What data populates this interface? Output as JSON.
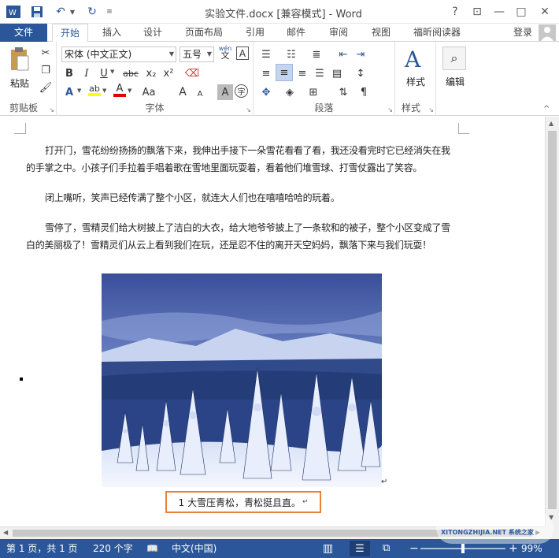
{
  "title": "实验文件.docx [兼容模式] - Word",
  "window_controls": {
    "help": "?",
    "restore_ribbon": "⊡",
    "minimize": "—",
    "maximize": "□",
    "close": "✕"
  },
  "tabs": [
    "文件",
    "开始",
    "插入",
    "设计",
    "页面布局",
    "引用",
    "邮件",
    "审阅",
    "视图",
    "福昕阅读器"
  ],
  "login": "登录",
  "ribbon": {
    "clipboard": {
      "paste": "粘贴",
      "label": "剪贴板"
    },
    "font": {
      "name": "宋体 (中文正文)",
      "size": "五号",
      "wen": "wén",
      "bold": "B",
      "italic": "I",
      "underline": "U",
      "strike": "abc",
      "sub": "x₂",
      "sup": "x²",
      "case": "Aa",
      "grow": "A",
      "shrink": "A",
      "label": "字体"
    },
    "paragraph": {
      "label": "段落"
    },
    "styles": {
      "label": "样式",
      "button": "样式"
    },
    "editing": {
      "button": "编辑"
    }
  },
  "document": {
    "p1a": "打开门，雪花纷纷扬扬的飘落下来，我伸出手接下一朵雪花看看了看，我还没看完时它已经消失在我",
    "p1b": "的手掌之中。小孩子们手拉着手唱着歌在雪地里面玩耍着，看着他们堆雪球、打雪仗露出了笑容。",
    "p2": "闭上嘴听，笑声已经传满了整个小区，就连大人们也在嘻嘻哈哈的玩着。",
    "p3a": "雪停了，雪精灵们给大树披上了洁白的大衣，给大地爷爷披上了一条软和的被子，整个小区变成了雪",
    "p3b": "白的美丽极了！雪精灵们从云上看到我们在玩，还是忍不住的离开天空妈妈，飘落下来与我们玩耍！",
    "caption": "1 大雪压青松，青松挺且直。"
  },
  "status": {
    "page": "第 1 页，共 1 页",
    "words": "220 个字",
    "lang": "中文(中国)",
    "zoom": "99%"
  },
  "watermark": "XITONGZHIJIA.NET 系统之家",
  "colors": {
    "accent": "#2b579a",
    "caption_border": "#e8823a",
    "highlight": "#ffff00",
    "font_color": "#e00000"
  }
}
